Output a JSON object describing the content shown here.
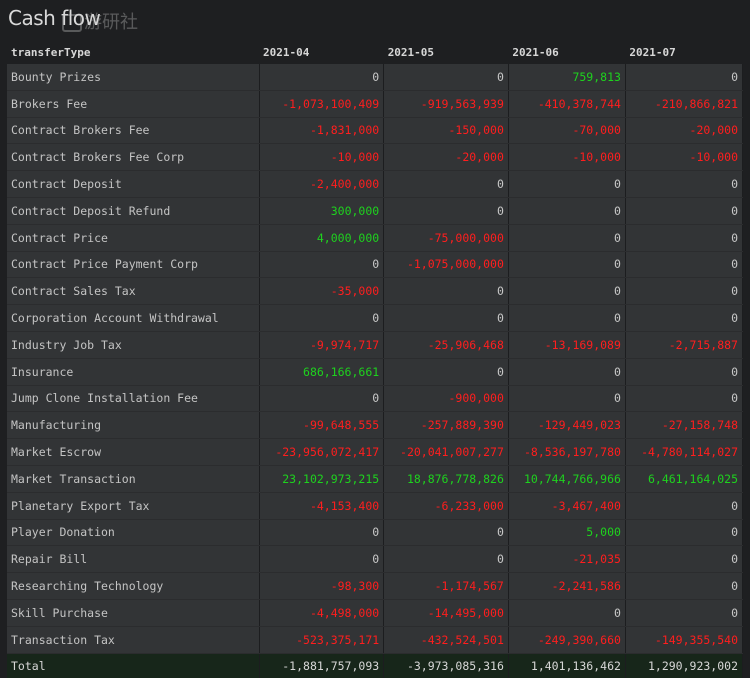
{
  "title": "Cash flow",
  "watermark": "游研社",
  "colors": {
    "negative": "#ff1e1e",
    "positive": "#1ed21e",
    "zero": "#c8c8c8"
  },
  "table": {
    "columns": [
      "transferType",
      "2021-04",
      "2021-05",
      "2021-06",
      "2021-07"
    ],
    "rows": [
      {
        "label": "Bounty Prizes",
        "values": [
          "0",
          "0",
          "759,813",
          "0"
        ]
      },
      {
        "label": "Brokers Fee",
        "values": [
          "-1,073,100,409",
          "-919,563,939",
          "-410,378,744",
          "-210,866,821"
        ]
      },
      {
        "label": "Contract Brokers Fee",
        "values": [
          "-1,831,000",
          "-150,000",
          "-70,000",
          "-20,000"
        ]
      },
      {
        "label": "Contract Brokers Fee Corp",
        "values": [
          "-10,000",
          "-20,000",
          "-10,000",
          "-10,000"
        ]
      },
      {
        "label": "Contract Deposit",
        "values": [
          "-2,400,000",
          "0",
          "0",
          "0"
        ]
      },
      {
        "label": "Contract Deposit Refund",
        "values": [
          "300,000",
          "0",
          "0",
          "0"
        ]
      },
      {
        "label": "Contract Price",
        "values": [
          "4,000,000",
          "-75,000,000",
          "0",
          "0"
        ]
      },
      {
        "label": "Contract Price Payment Corp",
        "values": [
          "0",
          "-1,075,000,000",
          "0",
          "0"
        ]
      },
      {
        "label": "Contract Sales Tax",
        "values": [
          "-35,000",
          "0",
          "0",
          "0"
        ]
      },
      {
        "label": "Corporation Account Withdrawal",
        "values": [
          "0",
          "0",
          "0",
          "0"
        ]
      },
      {
        "label": "Industry Job Tax",
        "values": [
          "-9,974,717",
          "-25,906,468",
          "-13,169,089",
          "-2,715,887"
        ]
      },
      {
        "label": "Insurance",
        "values": [
          "686,166,661",
          "0",
          "0",
          "0"
        ]
      },
      {
        "label": "Jump Clone Installation Fee",
        "values": [
          "0",
          "-900,000",
          "0",
          "0"
        ]
      },
      {
        "label": "Manufacturing",
        "values": [
          "-99,648,555",
          "-257,889,390",
          "-129,449,023",
          "-27,158,748"
        ]
      },
      {
        "label": "Market Escrow",
        "values": [
          "-23,956,072,417",
          "-20,041,007,277",
          "-8,536,197,780",
          "-4,780,114,027"
        ]
      },
      {
        "label": "Market Transaction",
        "values": [
          "23,102,973,215",
          "18,876,778,826",
          "10,744,766,966",
          "6,461,164,025"
        ]
      },
      {
        "label": "Planetary Export Tax",
        "values": [
          "-4,153,400",
          "-6,233,000",
          "-3,467,400",
          "0"
        ]
      },
      {
        "label": "Player Donation",
        "values": [
          "0",
          "0",
          "5,000",
          "0"
        ]
      },
      {
        "label": "Repair Bill",
        "values": [
          "0",
          "0",
          "-21,035",
          "0"
        ]
      },
      {
        "label": "Researching Technology",
        "values": [
          "-98,300",
          "-1,174,567",
          "-2,241,586",
          "0"
        ]
      },
      {
        "label": "Skill Purchase",
        "values": [
          "-4,498,000",
          "-14,495,000",
          "0",
          "0"
        ]
      },
      {
        "label": "Transaction Tax",
        "values": [
          "-523,375,171",
          "-432,524,501",
          "-249,390,660",
          "-149,355,540"
        ]
      }
    ],
    "total": {
      "label": "Total",
      "values": [
        "-1,881,757,093",
        "-3,973,085,316",
        "1,401,136,462",
        "1,290,923,002"
      ]
    }
  }
}
